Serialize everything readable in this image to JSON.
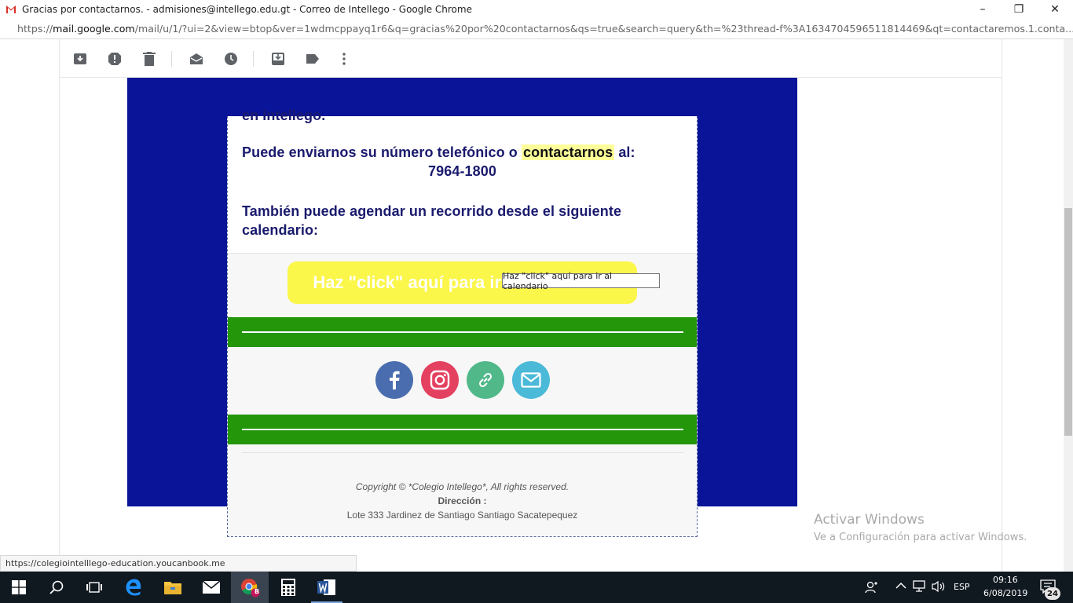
{
  "window": {
    "title": "Gracias por contactarnos. - admisiones@intellego.edu.gt - Correo de Intellego - Google Chrome",
    "minimize_glyph": "–",
    "restore_glyph": "❐",
    "close_glyph": "✕"
  },
  "address_bar": {
    "scheme": "https://",
    "host": "mail.google.com",
    "path": "/mail/u/1/?ui=2&view=btop&ver=1wdmcppayq1r6&q=gracias%20por%20contactarnos&qs=true&search=query&th=%23thread-f%3A1634704596511814469&qt=contactaremos.1.conta..."
  },
  "gmail_toolbar": {
    "icons": [
      "archive-icon",
      "report-spam-icon",
      "delete-icon",
      "mark-read-icon",
      "snooze-icon",
      "move-to-icon",
      "label-icon",
      "more-icon"
    ]
  },
  "email": {
    "partial_line": "en Intellego.",
    "phone_text_before": "Puede enviarnos su número telefónico o ",
    "phone_text_highlight": "contactarnos",
    "phone_text_after": " al:",
    "phone_number": "7964-1800",
    "calendar_text": "También puede agendar un recorrido desde el siguiente calendario:",
    "calendar_button": "Haz \"click\" aquí para ir al calendario",
    "social_icons": [
      "facebook-icon",
      "instagram-icon",
      "link-icon",
      "email-icon"
    ],
    "social_colors": {
      "facebook": "#4a6daf",
      "instagram": "#e4405f",
      "link": "#51b88a",
      "email": "#4bb9d8"
    },
    "footer": {
      "copyright": "Copyright © *Colegio Intellego*, All rights reserved.",
      "address_label": "Dirección :",
      "address_value": "Lote 333 Jardinez de Santiago Santiago Sacatepequez"
    }
  },
  "tooltip": "Haz \"click\" aquí para ir al calendario",
  "status_link": "https://colegiointelllego-education.youcanbook.me",
  "activate_windows": {
    "line1": "Activar Windows",
    "line2": "Ve a Configuración para activar Windows."
  },
  "taskbar": {
    "apps": [
      "start-icon",
      "search-icon",
      "task-view-icon",
      "edge-icon",
      "file-explorer-icon",
      "mail-icon",
      "chrome-icon",
      "calculator-icon",
      "word-icon"
    ],
    "chrome_badge": "B",
    "language": "ESP",
    "time": "09:16",
    "date": "6/08/2019",
    "notifications": "24"
  },
  "colors": {
    "email_bg": "#0a1499",
    "green_bar": "#23960a",
    "button_yellow": "#fbf64a",
    "text_navy": "#1a1a6e"
  }
}
